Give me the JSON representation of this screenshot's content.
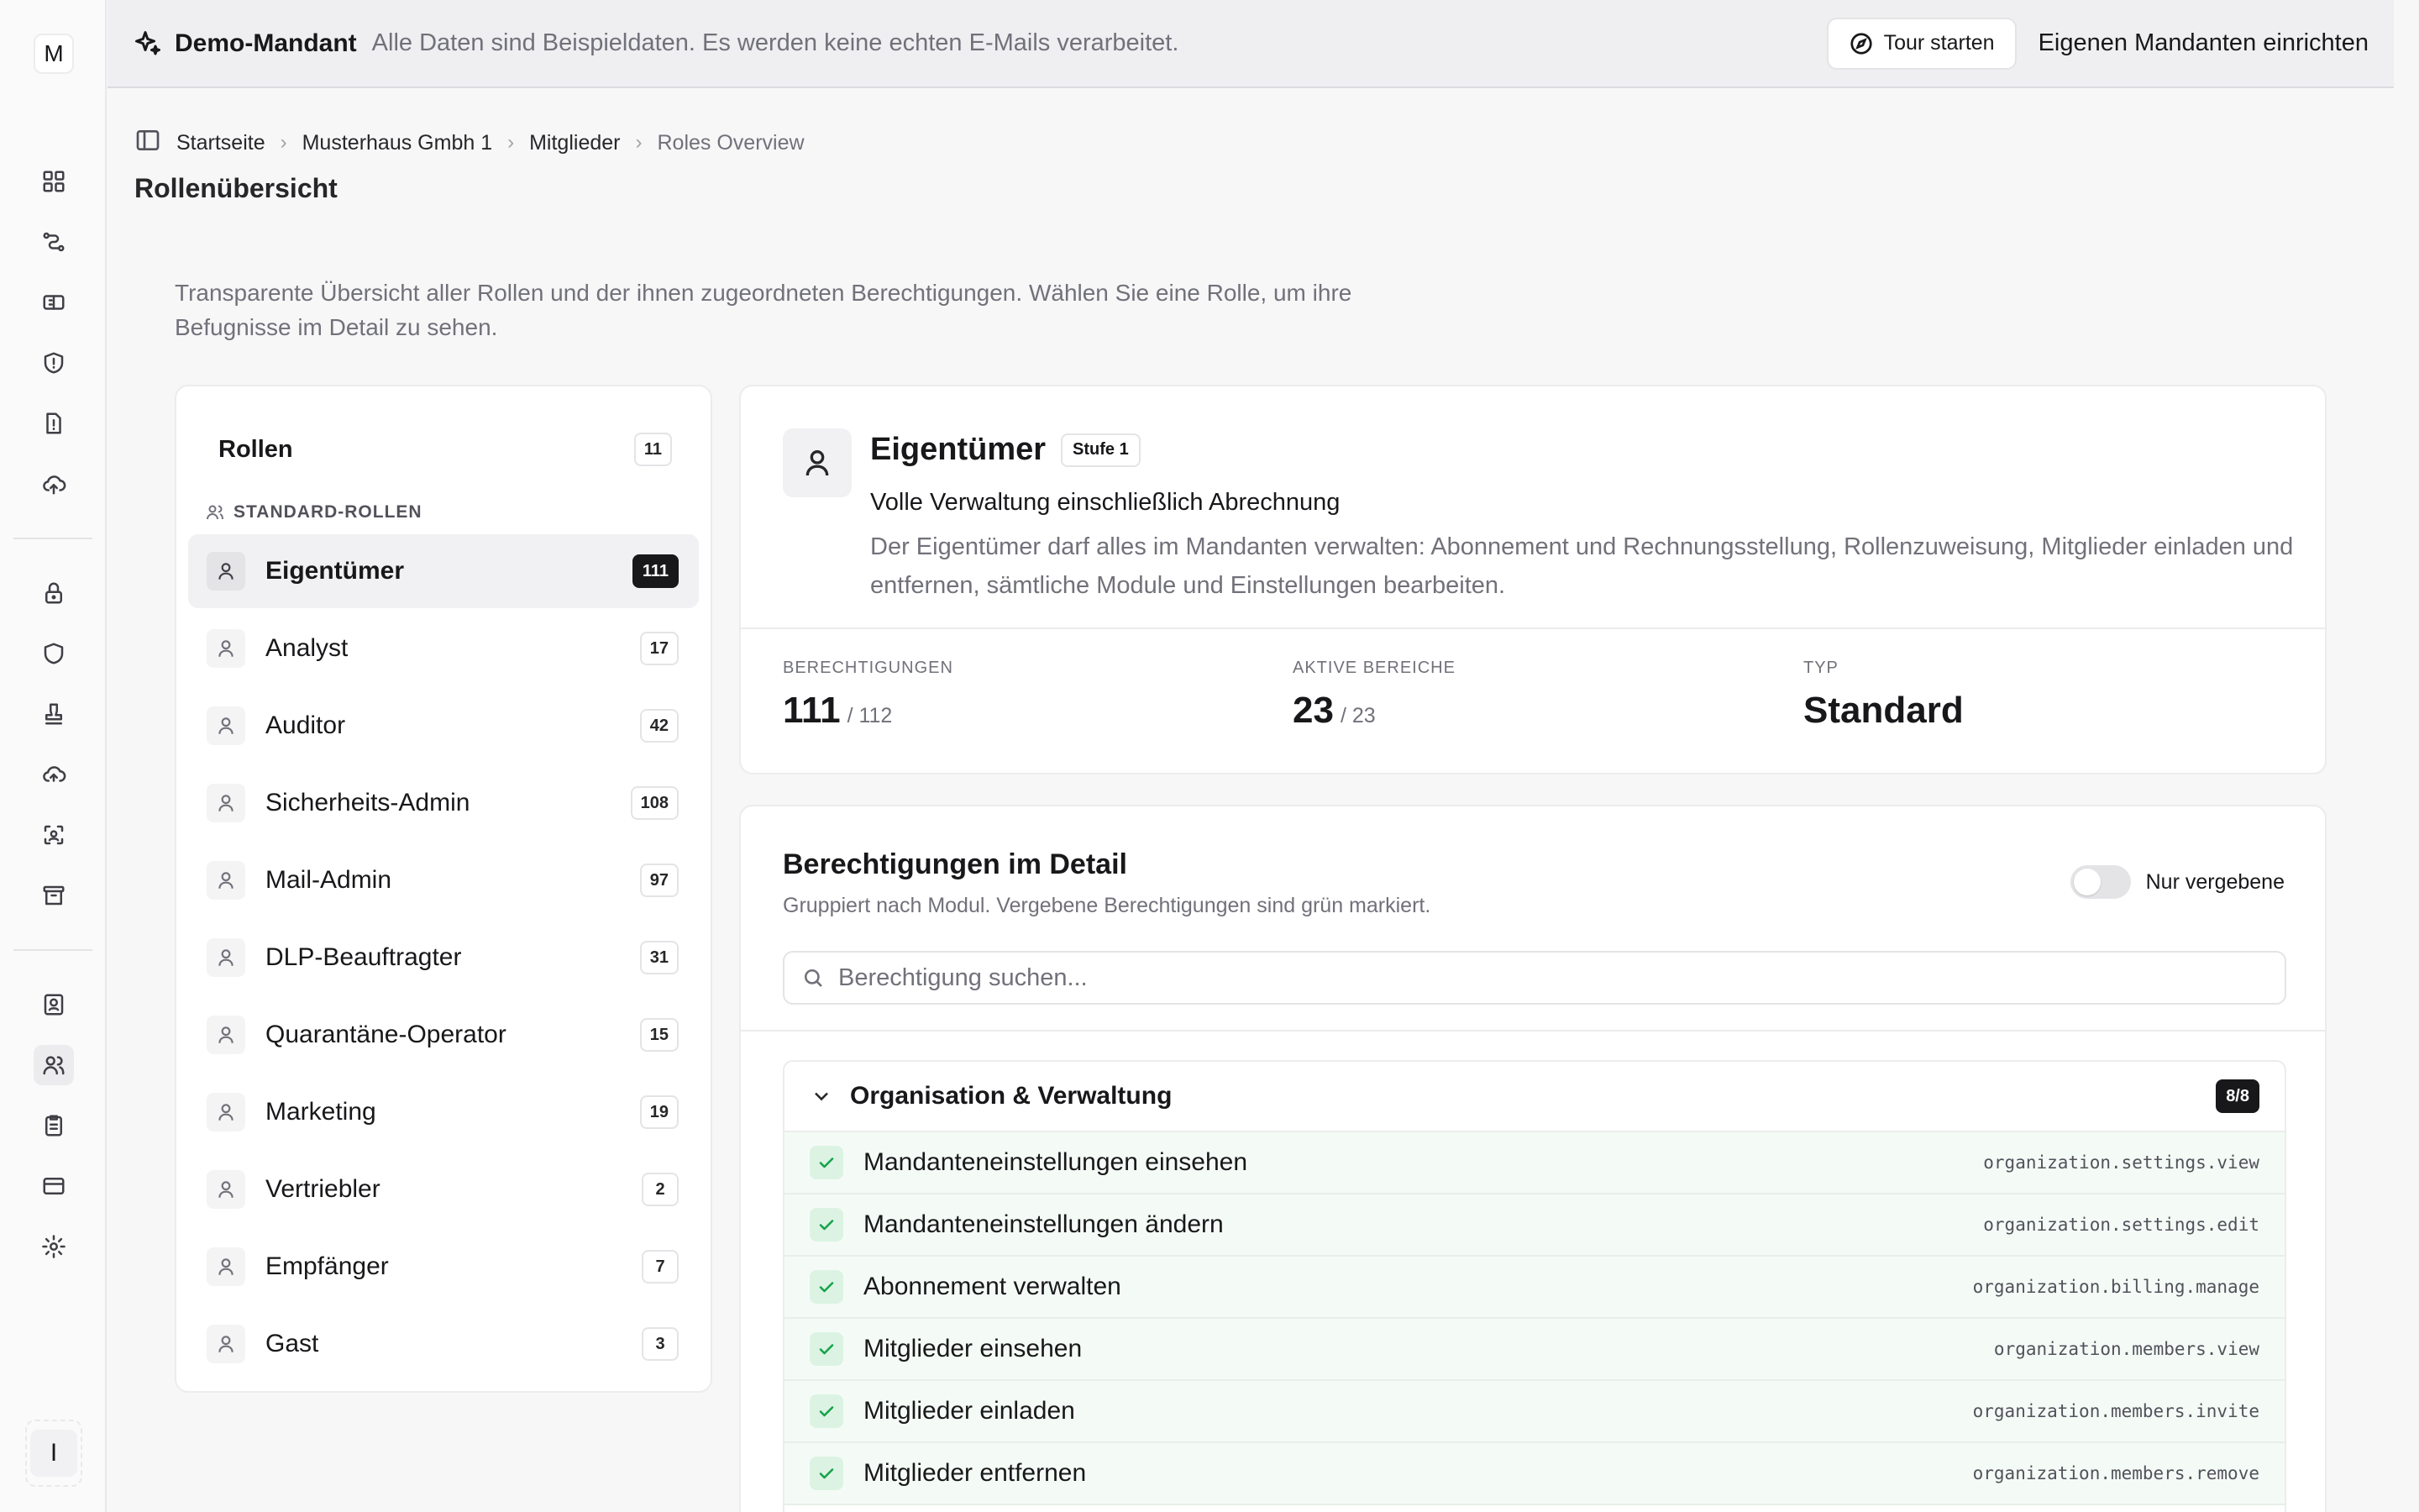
{
  "sidebar": {
    "logo": "M",
    "bottom_label": "I",
    "icons": [
      "dashboard-icon",
      "workflow-icon",
      "ticket-icon",
      "shield-alert-icon",
      "file-warning-icon",
      "cloud-upload-icon",
      "lock-icon",
      "shield-icon",
      "stamp-icon",
      "cloud-sync-icon",
      "scan-icon",
      "archive-icon",
      "contact-card-icon",
      "users-icon",
      "clipboard-icon",
      "credit-card-icon",
      "settings-icon"
    ]
  },
  "banner": {
    "title": "Demo-Mandant",
    "text": "Alle Daten sind Beispieldaten. Es werden keine echten E-Mails verarbeitet.",
    "tour_button": "Tour starten",
    "own_tenant_button": "Eigenen Mandanten einrichten"
  },
  "breadcrumb": {
    "items": [
      "Startseite",
      "Musterhaus Gmbh 1",
      "Mitglieder"
    ],
    "current": "Roles Overview"
  },
  "page": {
    "title": "Rollenübersicht",
    "intro": "Transparente Übersicht aller Rollen und der ihnen zugeordneten Berechtigungen. Wählen Sie eine Rolle, um ihre Befugnisse im Detail zu sehen."
  },
  "roles": {
    "title": "Rollen",
    "count": "11",
    "group_label": "STANDARD-ROLLEN",
    "items": [
      {
        "name": "Eigentümer",
        "count": "111",
        "selected": true
      },
      {
        "name": "Analyst",
        "count": "17"
      },
      {
        "name": "Auditor",
        "count": "42"
      },
      {
        "name": "Sicherheits-Admin",
        "count": "108"
      },
      {
        "name": "Mail-Admin",
        "count": "97"
      },
      {
        "name": "DLP-Beauftragter",
        "count": "31"
      },
      {
        "name": "Quarantäne-Operator",
        "count": "15"
      },
      {
        "name": "Marketing",
        "count": "19"
      },
      {
        "name": "Vertriebler",
        "count": "2"
      },
      {
        "name": "Empfänger",
        "count": "7"
      },
      {
        "name": "Gast",
        "count": "3"
      }
    ]
  },
  "detail": {
    "title": "Eigentümer",
    "level": "Stufe 1",
    "subtitle": "Volle Verwaltung einschließlich Abrechnung",
    "description": "Der Eigentümer darf alles im Mandanten verwalten: Abonnement und Rechnungsstellung, Rollenzuweisung, Mitglieder einladen und entfernen, sämtliche Module und Einstellungen bearbeiten.",
    "stats": {
      "permissions_label": "BERECHTIGUNGEN",
      "permissions_value": "111",
      "permissions_total": "/ 112",
      "areas_label": "AKTIVE BEREICHE",
      "areas_value": "23",
      "areas_total": "/ 23",
      "type_label": "TYP",
      "type_value": "Standard"
    }
  },
  "permissions": {
    "title": "Berechtigungen im Detail",
    "subtitle": "Gruppiert nach Modul. Vergebene Berechtigungen sind grün markiert.",
    "toggle_label": "Nur vergebene",
    "toggle_on": false,
    "search_placeholder": "Berechtigung suchen...",
    "group": {
      "name": "Organisation & Verwaltung",
      "count": "8/8",
      "rows": [
        {
          "name": "Mandanteneinstellungen einsehen",
          "key": "organization.settings.view"
        },
        {
          "name": "Mandanteneinstellungen ändern",
          "key": "organization.settings.edit"
        },
        {
          "name": "Abonnement verwalten",
          "key": "organization.billing.manage"
        },
        {
          "name": "Mitglieder einsehen",
          "key": "organization.members.view"
        },
        {
          "name": "Mitglieder einladen",
          "key": "organization.members.invite"
        },
        {
          "name": "Mitglieder entfernen",
          "key": "organization.members.remove"
        }
      ]
    }
  }
}
